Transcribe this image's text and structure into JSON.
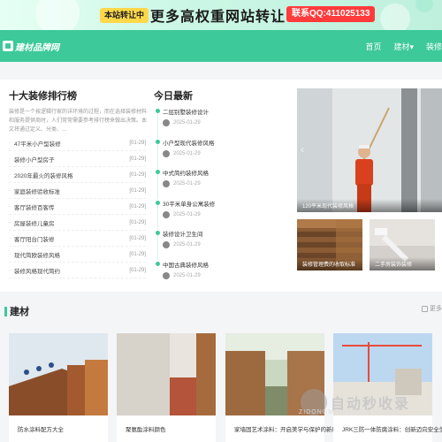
{
  "ad": {
    "tag": "本站转让中",
    "slogan": "更多高权重网站转让",
    "contact": "联系QQ:411025133"
  },
  "header": {
    "logo_text": "建材品牌网",
    "nav": [
      "首页",
      "建材▾",
      "装修"
    ]
  },
  "ranking": {
    "title": "十大装修排行榜",
    "description": "装修是一个按逻辑行家的详环境的过程，而在选择装修材料和服务提供商时，人们常常需要参考排行榜来做出决策。本文将通过定义、分类、...",
    "items": [
      {
        "title": "47平米小户型装修",
        "date": "[01-29]"
      },
      {
        "title": "装修小户型房子",
        "date": "[01-29]"
      },
      {
        "title": "2020年最火的装修风格",
        "date": "[01-29]"
      },
      {
        "title": "家庭装修验收标准",
        "date": "[01-29]"
      },
      {
        "title": "客厅装修百客传",
        "date": "[01-29]"
      },
      {
        "title": "房屋装修儿童房",
        "date": "[01-29]"
      },
      {
        "title": "客厅阳台门装修",
        "date": "[01-29]"
      },
      {
        "title": "现代简欧装修风格",
        "date": "[01-29]"
      },
      {
        "title": "装修风格现代简约",
        "date": "[01-29]"
      }
    ]
  },
  "today": {
    "title": "今日最新",
    "items": [
      {
        "title": "二层别墅装修设计",
        "date": "2025-01-29"
      },
      {
        "title": "小户型现代装修风格",
        "date": "2025-01-29"
      },
      {
        "title": "中式简约装修风格",
        "date": "2025-01-29"
      },
      {
        "title": "30平米单身公寓装修",
        "date": "2025-01-29"
      },
      {
        "title": "装修设计卫生间",
        "date": "2025-01-29"
      },
      {
        "title": "中国古典装修风格",
        "date": "2025-01-29"
      }
    ]
  },
  "feature": {
    "main_caption": "120平米现代装修风格",
    "sub1_caption": "装修管理费的收取标准",
    "sub2_caption": "二手房装饰装修"
  },
  "section": {
    "title": "建材",
    "more": "更多",
    "cards": [
      {
        "title": "防水涂料配方大全"
      },
      {
        "title": "聚氨酯涂料颜色"
      },
      {
        "title": "家墙固艺术涂料：开启美学与保护的新时代"
      },
      {
        "title": "JRK三防一体防腐涂料：创新迈向安全生..."
      }
    ]
  },
  "watermark": {
    "title": "自动秒收录",
    "subtitle": "ZIDONGMIAOSHOULU.COM"
  },
  "colors": {
    "accent": "#3dc99a",
    "ad_tag": "#ffd84a",
    "ad_contact": "#ff3b3b"
  }
}
